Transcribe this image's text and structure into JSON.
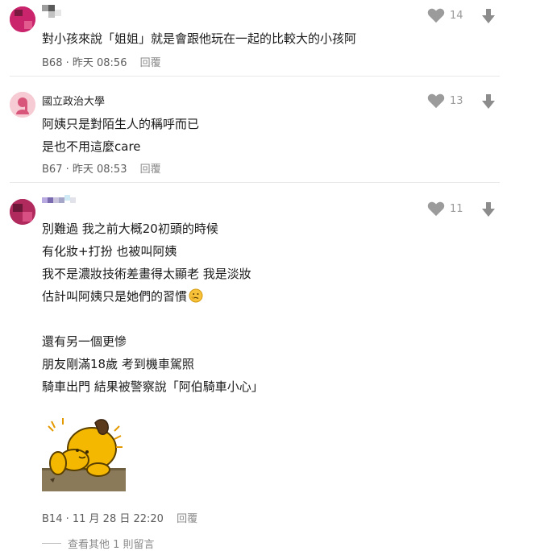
{
  "comments": [
    {
      "author": "",
      "lines": [
        "對小孩來說「姐姐」就是會跟他玩在一起的比較大的小孩阿"
      ],
      "floor": "B68",
      "time": "昨天 08:56",
      "reply": "回覆",
      "likes": "14"
    },
    {
      "author": "國立政治大學",
      "lines": [
        "阿姨只是對陌生人的稱呼而已",
        "是也不用這麼care"
      ],
      "floor": "B67",
      "time": "昨天 08:53",
      "reply": "回覆",
      "likes": "13"
    },
    {
      "author": "",
      "lines": [
        "別難過 我之前大概20初頭的時候",
        "有化妝+打扮 也被叫阿姨",
        "我不是濃妝技術差畫得太顯老 我是淡妝",
        "估計叫阿姨只是她們的習慣",
        "",
        "還有另一個更慘",
        "朋友剛滿18歲 考到機車駕照",
        "騎車出門 結果被警察說「阿伯騎車小心」"
      ],
      "floor": "B14",
      "time": "11 月 28 日 22:20",
      "reply": "回覆",
      "likes": "11"
    }
  ],
  "view_more": "查看其他 1 則留言",
  "colors": {
    "like_icon": "#9b9b9b",
    "dislike_icon": "#8c8c8c",
    "sticker_bg": "#8b7a5a",
    "sticker_dog": "#f5b800",
    "avatar_school_bg": "#f6cbd3",
    "avatar_school_fg": "#d8567a"
  },
  "icons": [
    "heart-icon",
    "arrow-down-icon",
    "thinking-emoji-icon",
    "sticker-dog-icon"
  ]
}
